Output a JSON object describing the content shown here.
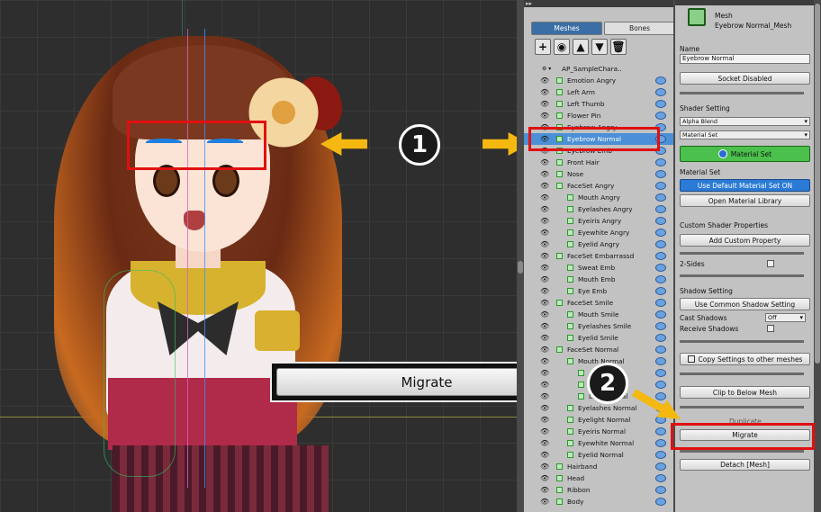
{
  "callouts": {
    "badge1": "1",
    "badge2": "2",
    "zoom_migrate_label": "Migrate"
  },
  "hierarchy": {
    "tabs": [
      "Meshes",
      "Bones"
    ],
    "root": "AP_SampleChara..",
    "selected": "Eyebrow Normal",
    "rows": [
      {
        "label": "Emotion Angry",
        "indent": 1
      },
      {
        "label": "Left Arm",
        "indent": 1
      },
      {
        "label": "Left Thumb",
        "indent": 1
      },
      {
        "label": "Flower Pin",
        "indent": 1
      },
      {
        "label": "Eyebrow Angry",
        "indent": 1
      },
      {
        "label": "Eyebrow Normal",
        "indent": 1
      },
      {
        "label": "Eyebrow Emb",
        "indent": 1
      },
      {
        "label": "Front Hair",
        "indent": 1
      },
      {
        "label": "Nose",
        "indent": 1
      },
      {
        "label": "FaceSet Angry",
        "indent": 1
      },
      {
        "label": "Mouth Angry",
        "indent": 2
      },
      {
        "label": "Eyelashes Angry",
        "indent": 2
      },
      {
        "label": "Eyeiris Angry",
        "indent": 2
      },
      {
        "label": "Eyewhite Angry",
        "indent": 2
      },
      {
        "label": "Eyelid Angry",
        "indent": 2
      },
      {
        "label": "FaceSet Embarrassd",
        "indent": 1
      },
      {
        "label": "Sweat Emb",
        "indent": 2
      },
      {
        "label": "Mouth Emb",
        "indent": 2
      },
      {
        "label": "Eye Emb",
        "indent": 2
      },
      {
        "label": "FaceSet Smile",
        "indent": 1
      },
      {
        "label": "Mouth Smile",
        "indent": 2
      },
      {
        "label": "Eyelashes Smile",
        "indent": 2
      },
      {
        "label": "Eyelid Smile",
        "indent": 2
      },
      {
        "label": "FaceSet Normal",
        "indent": 1
      },
      {
        "label": "Mouth Normal",
        "indent": 2
      },
      {
        "label": "",
        "indent": 3
      },
      {
        "label": "",
        "indent": 3
      },
      {
        "label": "Lips Normal",
        "indent": 3
      },
      {
        "label": "Eyelashes Normal",
        "indent": 2
      },
      {
        "label": "Eyelight Normal",
        "indent": 2
      },
      {
        "label": "Eyeiris Normal",
        "indent": 2
      },
      {
        "label": "Eyewhite Normal",
        "indent": 2
      },
      {
        "label": "Eyelid Normal",
        "indent": 2
      },
      {
        "label": "Hairband",
        "indent": 1
      },
      {
        "label": "Head",
        "indent": 1
      },
      {
        "label": "Ribbon",
        "indent": 1
      },
      {
        "label": "Body",
        "indent": 1
      }
    ]
  },
  "inspector": {
    "type_label": "Mesh",
    "object_name": "Eyebrow Normal_Mesh",
    "name_label": "Name",
    "name_value": "Eyebrow Normal",
    "socket_button": "Socket Disabled",
    "shader_setting_label": "Shader Setting",
    "blend_value": "Alpha Blend",
    "material_set_dd": "Material Set",
    "material_set_button": "Material Set",
    "material_set_label": "Material Set",
    "use_default_button": "Use Default Material Set ON",
    "open_library_button": "Open Material Library",
    "custom_shader_label": "Custom Shader Properties",
    "add_custom_button": "Add Custom Property",
    "two_sides_label": "2-Sides",
    "shadow_setting_label": "Shadow Setting",
    "use_common_shadow_button": "Use Common Shadow Setting",
    "cast_shadows_label": "Cast Shadows",
    "cast_shadows_value": "Off",
    "receive_shadows_label": "Receive Shadows",
    "copy_settings_button": "Copy Settings to other meshes",
    "clip_button": "Clip to Below Mesh",
    "duplicate_label": "Duplicate",
    "migrate_button": "Migrate",
    "detach_button": "Detach [Mesh]"
  },
  "colors": {
    "highlight": "#e01010",
    "arrow": "#f4b810",
    "selection": "#4b8fd6",
    "accent_blue": "#2a7ad6",
    "accent_green": "#4cc04c"
  }
}
